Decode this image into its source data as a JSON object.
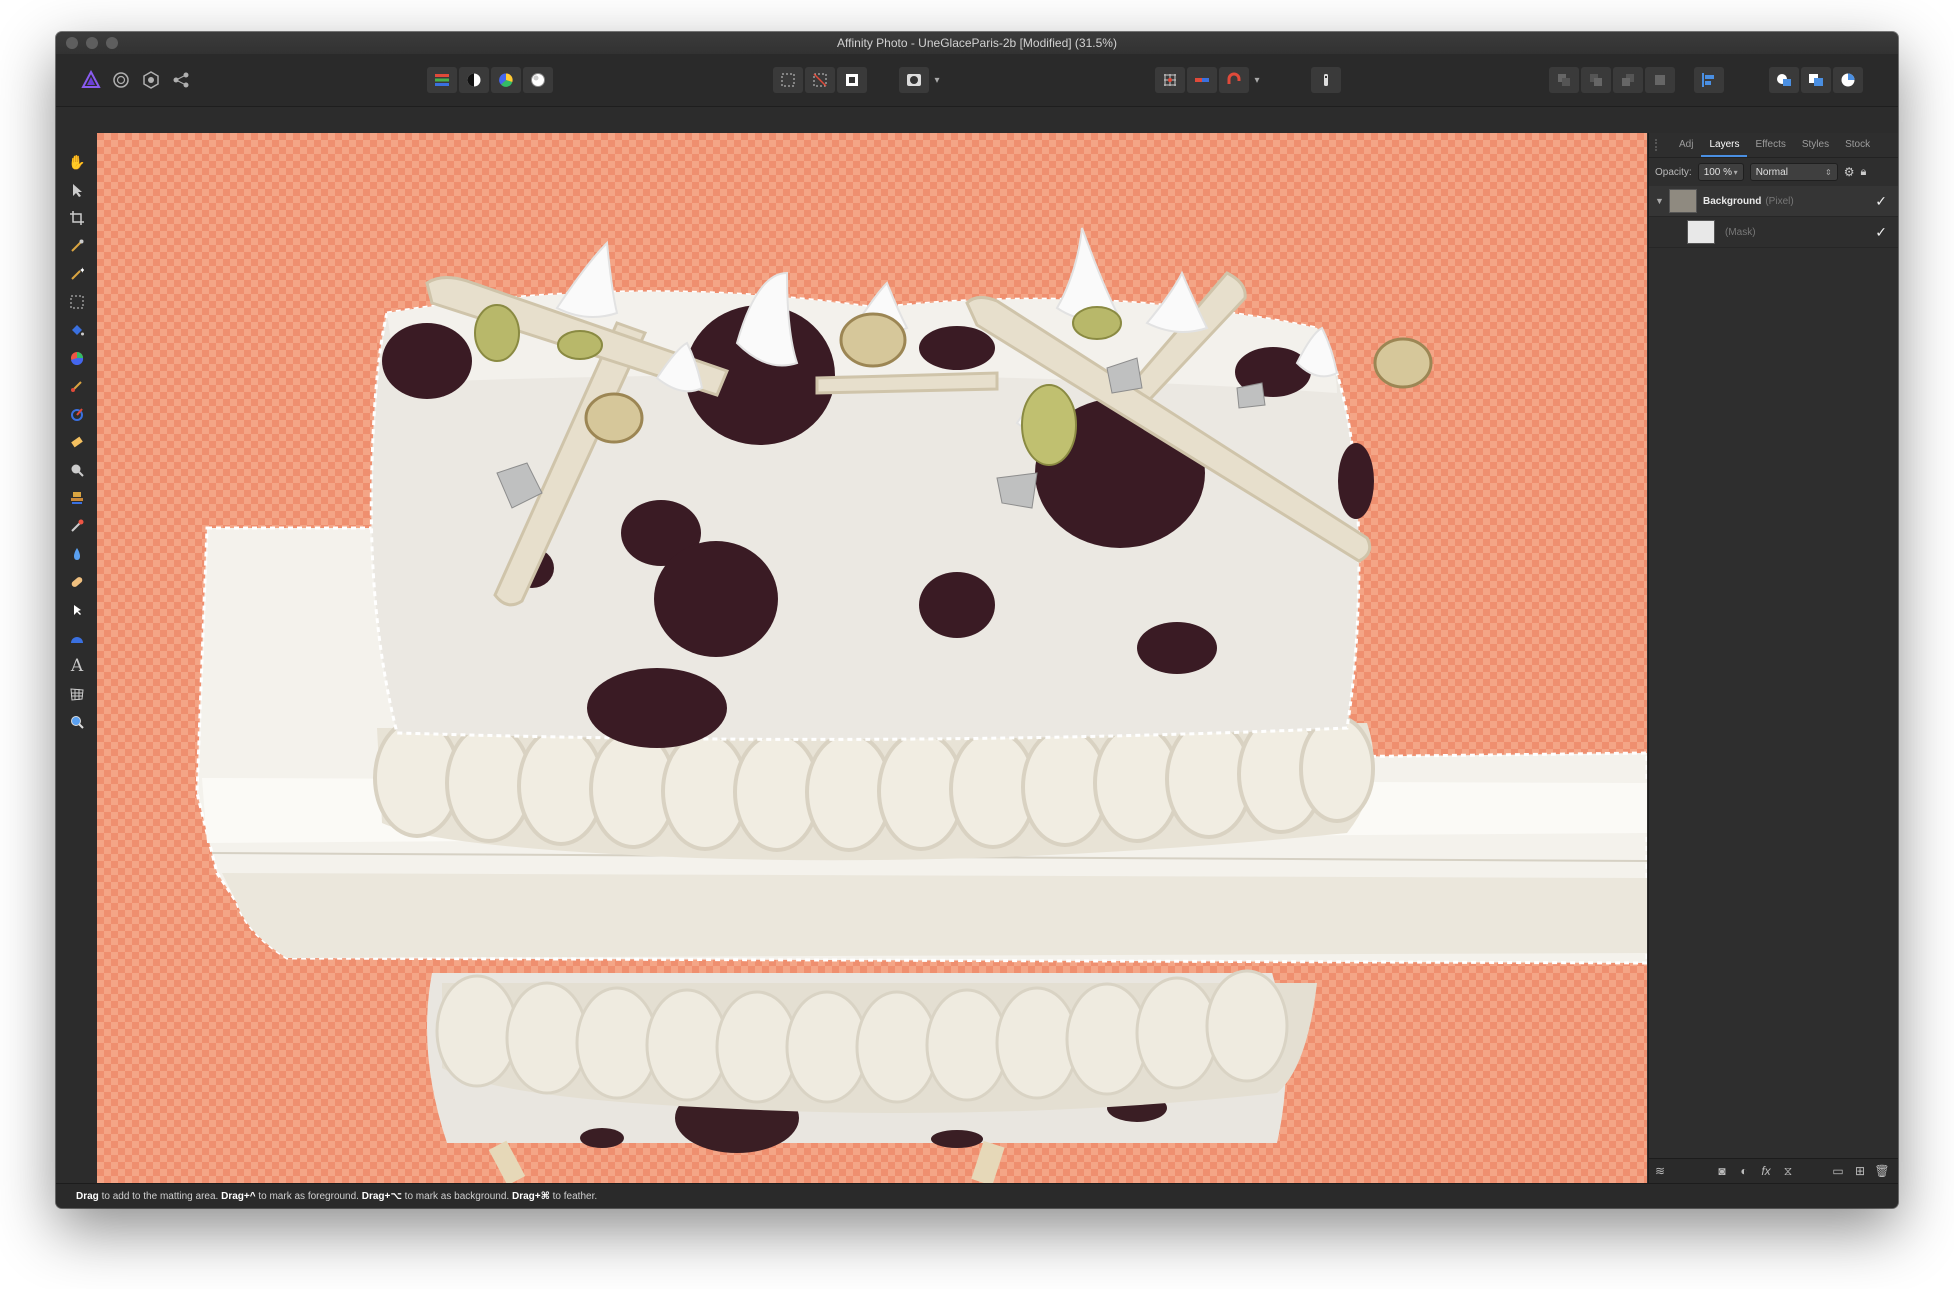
{
  "window": {
    "title": "Affinity Photo - UneGlaceParis-2b [Modified] (31.5%)"
  },
  "toolbar": {
    "personas": [
      "affinity-photo-icon",
      "liquify-persona-icon",
      "develop-persona-icon",
      "export-persona-icon"
    ],
    "adjustments": [
      "levels-icon",
      "contrast-icon",
      "color-wheel-icon",
      "white-balance-icon"
    ],
    "selection": [
      "marquee-icon",
      "deselect-icon",
      "invert-selection-icon"
    ],
    "quickmask": [
      "quick-mask-icon"
    ],
    "snapping": [
      "grid-icon",
      "force-pixel-icon",
      "snapping-magnet-icon"
    ],
    "arrange": [
      "order-back-icon",
      "order-backward-icon",
      "order-forward-icon",
      "order-front-icon",
      "align-icon"
    ],
    "boolean": [
      "add-icon",
      "subtract-icon",
      "intersect-icon"
    ]
  },
  "tools": [
    "hand-tool",
    "move-tool",
    "crop-tool",
    "selection-brush-tool",
    "magic-wand-tool",
    "marquee-tool",
    "flood-fill-tool",
    "color-picker-tool",
    "paint-brush-tool",
    "color-replacement-tool",
    "erase-brush-tool",
    "dodge-tool",
    "clone-tool",
    "smudge-tool",
    "blur-tool",
    "healing-tool",
    "node-tool",
    "shape-tool",
    "text-tool",
    "mesh-warp-tool",
    "zoom-tool"
  ],
  "panel": {
    "tabs": [
      "Adj",
      "Layers",
      "Effects",
      "Styles",
      "Stock"
    ],
    "active_tab": "Layers",
    "opacity_label": "Opacity:",
    "opacity_value": "100 %",
    "blend_mode": "Normal",
    "layers": [
      {
        "name": "Background",
        "type": "(Pixel)",
        "visible": true
      },
      {
        "name": "",
        "type": "(Mask)",
        "visible": true
      }
    ]
  },
  "status": {
    "s1_bold": "Drag",
    "s1": " to add to the matting area. ",
    "s2_bold": "Drag+^",
    "s2": " to mark as foreground. ",
    "s3_bold": "Drag+⌥",
    "s3": " to mark as background. ",
    "s4_bold": "Drag+⌘",
    "s4": " to feather."
  }
}
